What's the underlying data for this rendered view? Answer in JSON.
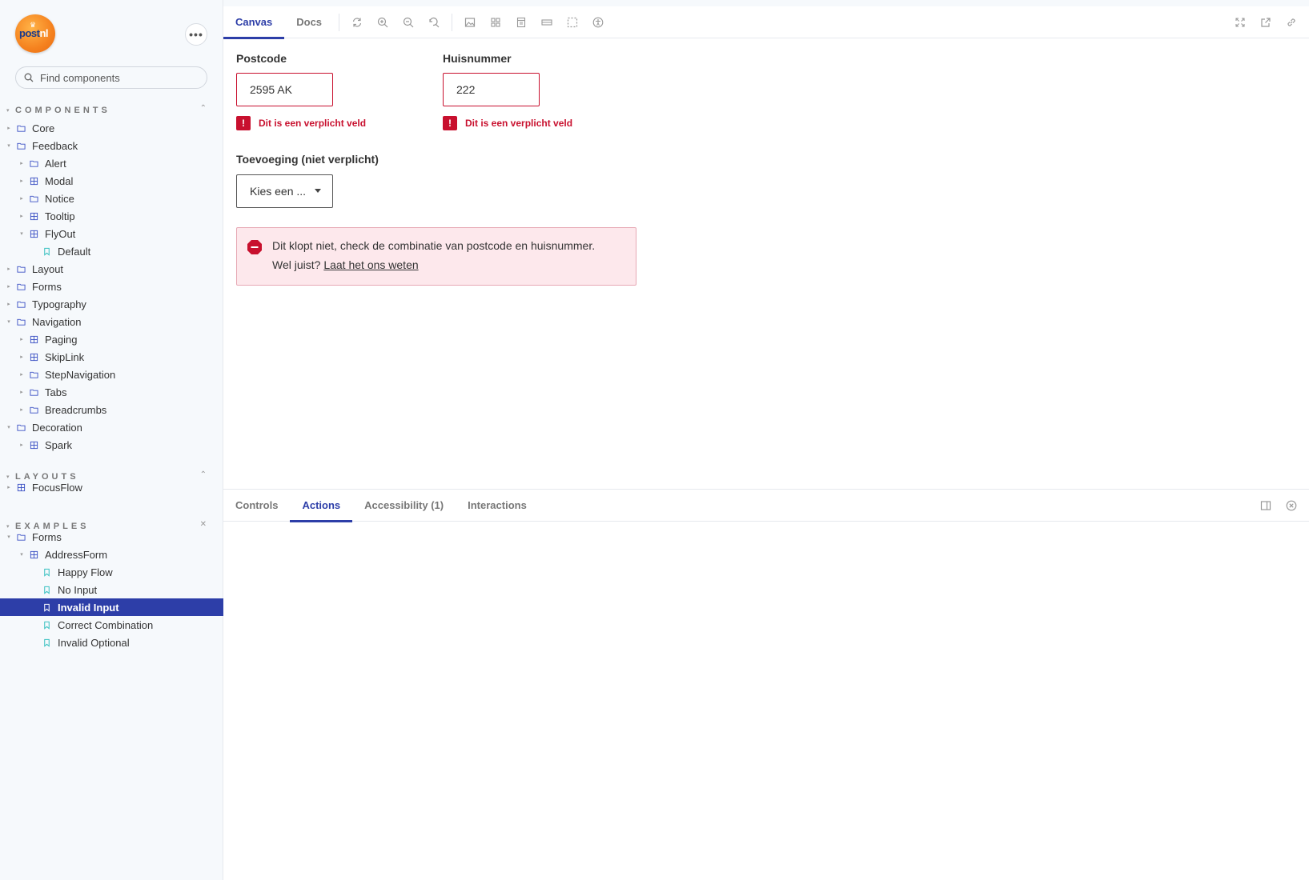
{
  "logo": {
    "text_main": "post",
    "text_accent": "nl"
  },
  "search": {
    "placeholder": "Find components"
  },
  "sections": {
    "components": "COMPONENTS",
    "layouts": "LAYOUTS",
    "examples": "EXAMPLES"
  },
  "tree": {
    "components": [
      {
        "label": "Core"
      },
      {
        "label": "Feedback"
      },
      {
        "label": "Alert"
      },
      {
        "label": "Modal"
      },
      {
        "label": "Notice"
      },
      {
        "label": "Tooltip"
      },
      {
        "label": "FlyOut"
      },
      {
        "label": "Default"
      },
      {
        "label": "Layout"
      },
      {
        "label": "Forms"
      },
      {
        "label": "Typography"
      },
      {
        "label": "Navigation"
      },
      {
        "label": "Paging"
      },
      {
        "label": "SkipLink"
      },
      {
        "label": "StepNavigation"
      },
      {
        "label": "Tabs"
      },
      {
        "label": "Breadcrumbs"
      },
      {
        "label": "Decoration"
      },
      {
        "label": "Spark"
      }
    ],
    "layouts": [
      {
        "label": "FocusFlow"
      }
    ],
    "examples": [
      {
        "label": "Forms"
      },
      {
        "label": "AddressForm"
      },
      {
        "label": "Happy Flow"
      },
      {
        "label": "No Input"
      },
      {
        "label": "Invalid Input"
      },
      {
        "label": "Correct Combination"
      },
      {
        "label": "Invalid Optional"
      }
    ]
  },
  "toolbar": {
    "tab_canvas": "Canvas",
    "tab_docs": "Docs"
  },
  "form": {
    "postcode_label": "Postcode",
    "postcode_value": "2595 AK",
    "huisnummer_label": "Huisnummer",
    "huisnummer_value": "222",
    "error_required": "Dit is een verplicht veld",
    "toevoeging_label": "Toevoeging (niet verplicht)",
    "toevoeging_selected": "Kies een ...",
    "alert_text": "Dit klopt niet, check de combinatie van postcode en huisnummer.",
    "alert_text2": "Wel juist?",
    "alert_link": "Laat het ons weten"
  },
  "addons": {
    "tab_controls": "Controls",
    "tab_actions": "Actions",
    "tab_accessibility": "Accessibility (1)",
    "tab_interactions": "Interactions"
  },
  "colors": {
    "accent": "#2d3ea8",
    "error": "#c8102e",
    "alert_bg": "#fde8ec",
    "brand_orange": "#f5821f"
  }
}
